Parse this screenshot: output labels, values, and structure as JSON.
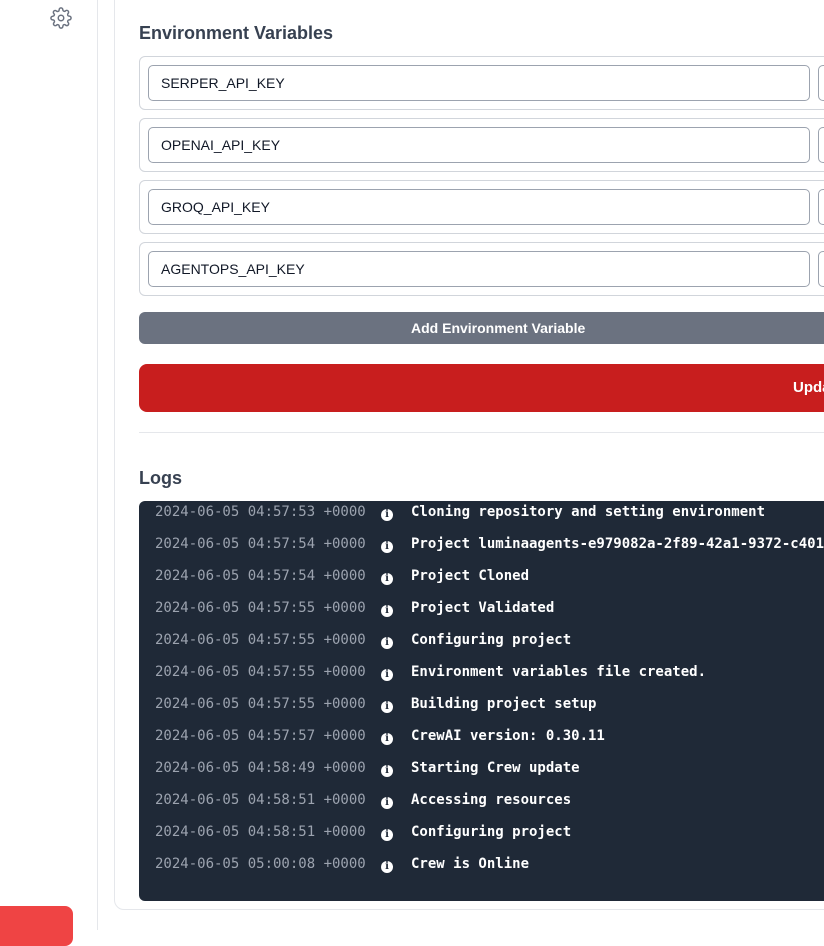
{
  "sidebar": {
    "settings_icon": "gear-icon"
  },
  "environment": {
    "title": "Environment Variables",
    "variables": [
      {
        "name": "SERPER_API_KEY"
      },
      {
        "name": "OPENAI_API_KEY"
      },
      {
        "name": "GROQ_API_KEY"
      },
      {
        "name": "AGENTOPS_API_KEY"
      }
    ],
    "add_button_label": "Add Environment Variable",
    "update_button_label": "Upda"
  },
  "logs": {
    "title": "Logs",
    "entries": [
      {
        "timestamp": "2024-06-05 04:57:53 +0000",
        "message": "Cloning repository and setting environment"
      },
      {
        "timestamp": "2024-06-05 04:57:54 +0000",
        "message": "Project luminaagents-e979082a-2f89-42a1-9372-c401"
      },
      {
        "timestamp": "2024-06-05 04:57:54 +0000",
        "message": "Project Cloned"
      },
      {
        "timestamp": "2024-06-05 04:57:55 +0000",
        "message": "Project Validated"
      },
      {
        "timestamp": "2024-06-05 04:57:55 +0000",
        "message": "Configuring project"
      },
      {
        "timestamp": "2024-06-05 04:57:55 +0000",
        "message": "Environment variables file created."
      },
      {
        "timestamp": "2024-06-05 04:57:55 +0000",
        "message": "Building project setup"
      },
      {
        "timestamp": "2024-06-05 04:57:57 +0000",
        "message": "CrewAI version: 0.30.11"
      },
      {
        "timestamp": "2024-06-05 04:58:49 +0000",
        "message": "Starting Crew update"
      },
      {
        "timestamp": "2024-06-05 04:58:51 +0000",
        "message": "Accessing resources"
      },
      {
        "timestamp": "2024-06-05 04:58:51 +0000",
        "message": "Configuring project"
      },
      {
        "timestamp": "2024-06-05 05:00:08 +0000",
        "message": "Crew is Online"
      }
    ]
  },
  "colors": {
    "update_button": "#c81e1e",
    "add_button": "#6b7280",
    "logs_background": "#1f2937",
    "sidebar_red": "#ef4444"
  }
}
